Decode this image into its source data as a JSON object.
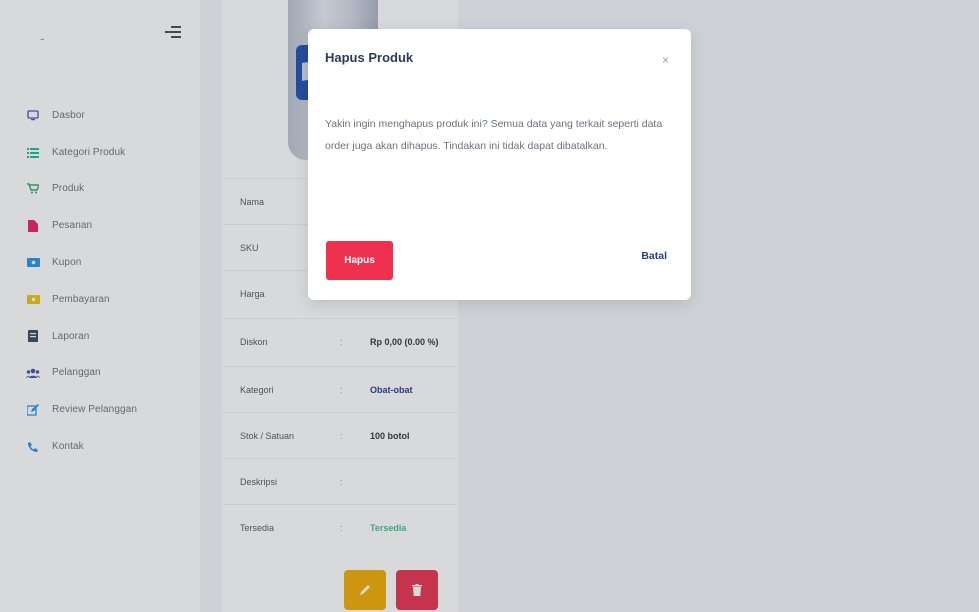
{
  "sidebar": {
    "brand": "-",
    "items": [
      {
        "label": "Dasbor",
        "icon": "monitor-icon",
        "color": "#3f51b5"
      },
      {
        "label": "Kategori Produk",
        "icon": "list-icon",
        "color": "#1abc9c"
      },
      {
        "label": "Produk",
        "icon": "cart-icon",
        "color": "#27ae60"
      },
      {
        "label": "Pesanan",
        "icon": "document-icon",
        "color": "#e91e63"
      },
      {
        "label": "Kupon",
        "icon": "ticket-icon",
        "color": "#2196f3"
      },
      {
        "label": "Pembayaran",
        "icon": "wallet-icon",
        "color": "#f1c40f"
      },
      {
        "label": "Laporan",
        "icon": "book-icon",
        "color": "#34495e"
      },
      {
        "label": "Pelanggan",
        "icon": "users-icon",
        "color": "#3f51b5"
      },
      {
        "label": "Review Pelanggan",
        "icon": "edit-icon",
        "color": "#2196f3"
      },
      {
        "label": "Kontak",
        "icon": "phone-icon",
        "color": "#2196f3"
      }
    ]
  },
  "product": {
    "rows": [
      {
        "label": "Nama",
        "value": ""
      },
      {
        "label": "SKU",
        "value": ""
      },
      {
        "label": "Harga",
        "value": ""
      },
      {
        "label": "Diskon",
        "value": "Rp 0,00 (0.00 %)"
      },
      {
        "label": "Kategori",
        "value": "Obat-obat"
      },
      {
        "label": "Stok / Satuan",
        "value": "100 botol"
      },
      {
        "label": "Deskripsi",
        "value": ""
      },
      {
        "label": "Tersedia",
        "value": "Tersedia"
      }
    ],
    "separator": ":"
  },
  "modal": {
    "title": "Hapus Produk",
    "close": "×",
    "message": "Yakin ingin menghapus produk ini? Semua data yang terkait seperti data order juga akan dihapus. Tindakan ini tidak dapat dibatalkan.",
    "confirm_label": "Hapus",
    "cancel_label": "Batal"
  },
  "colors": {
    "danger": "#f0304f",
    "warning": "#f0ad00",
    "primary": "#2c3e8c",
    "success": "#3cc28c"
  }
}
